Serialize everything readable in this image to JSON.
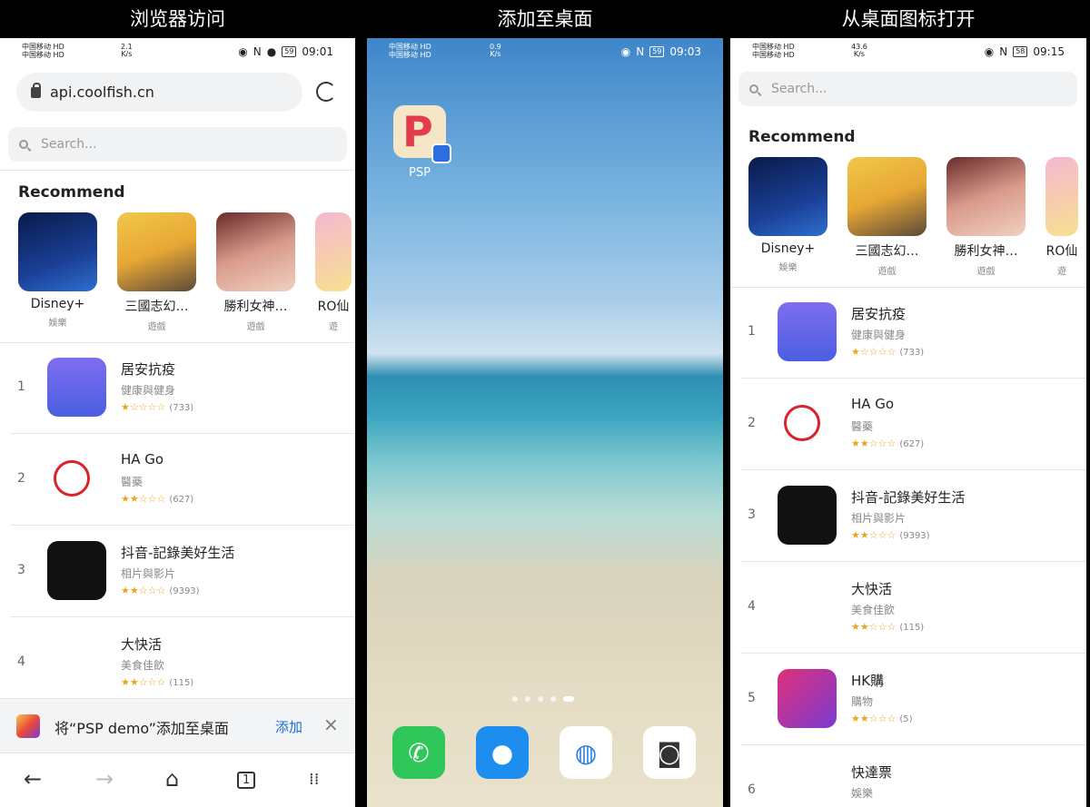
{
  "captions": [
    "浏览器访问",
    "添加至桌面",
    "从桌面图标打开"
  ],
  "status": {
    "carrier1": "中国移动",
    "carrier2": "中国移动",
    "hd": "HD",
    "p1_speed": "2.1",
    "p2_speed": "0.9",
    "p3_speed": "43.6",
    "speed_unit": "K/s",
    "p1_batt": "59",
    "p2_batt": "59",
    "p3_batt": "58",
    "p1_time": "09:01",
    "p2_time": "09:03",
    "p3_time": "09:15"
  },
  "browser": {
    "url": "api.coolfish.cn",
    "search_placeholder": "Search...",
    "banner_text": "将“PSP demo”添加至桌面",
    "banner_add": "添加"
  },
  "recommend_title": "Recommend",
  "recommend": [
    {
      "name": "Disney+",
      "category": "娛樂"
    },
    {
      "name": "三國志幻…",
      "category": "遊戲"
    },
    {
      "name": "勝利女神…",
      "category": "遊戲"
    },
    {
      "name": "RO仙",
      "category": "遊"
    }
  ],
  "apps": [
    {
      "rank": "1",
      "name": "居安抗疫",
      "category": "健康與健身",
      "stars": "★☆☆☆☆",
      "count": "(733)"
    },
    {
      "rank": "2",
      "name": "HA Go",
      "category": "醫藥",
      "stars": "★★☆☆☆",
      "count": "(627)"
    },
    {
      "rank": "3",
      "name": "抖音-記錄美好生活",
      "category": "相片與影片",
      "stars": "★★☆☆☆",
      "count": "(9393)"
    },
    {
      "rank": "4",
      "name": "大快活",
      "category": "美食佳飲",
      "stars": "★★☆☆☆",
      "count": "(115)"
    },
    {
      "rank": "5",
      "name": "HK購",
      "category": "購物",
      "stars": "★★☆☆☆",
      "count": "(5)"
    },
    {
      "rank": "6",
      "name": "快達票",
      "category": "娛樂",
      "stars": "",
      "count": ""
    }
  ],
  "home": {
    "psp_label": "PSP"
  },
  "colors": {
    "accent_blue": "#1a6fd6",
    "star": "#e9a51c"
  }
}
